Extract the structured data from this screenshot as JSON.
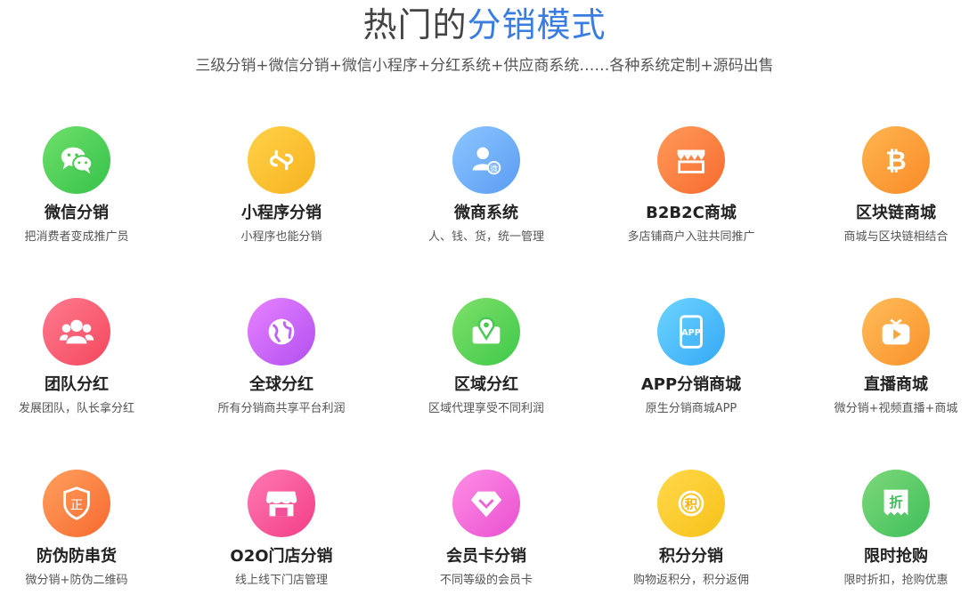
{
  "header": {
    "title_prefix": "热门的",
    "title_accent": "分销模式",
    "subtitle": "三级分销+微信分销+微信小程序+分红系统+供应商系统……各种系统定制+源码出售"
  },
  "colors": {
    "accent": "#3a7de0"
  },
  "items": [
    {
      "name": "微信分销",
      "desc": "把消费者变成推广员",
      "icon": "wechat-icon"
    },
    {
      "name": "小程序分销",
      "desc": "小程序也能分销",
      "icon": "mini-program-icon"
    },
    {
      "name": "微商系统",
      "desc": "人、钱、货，统一管理",
      "icon": "weishang-user-icon"
    },
    {
      "name": "B2B2C商城",
      "desc": "多店铺商户入驻共同推广",
      "icon": "storefront-icon"
    },
    {
      "name": "区块链商城",
      "desc": "商城与区块链相结合",
      "icon": "bitcoin-icon"
    },
    {
      "name": "团队分红",
      "desc": "发展团队，队长拿分红",
      "icon": "team-icon"
    },
    {
      "name": "全球分红",
      "desc": "所有分销商共享平台利润",
      "icon": "globe-icon"
    },
    {
      "name": "区域分红",
      "desc": "区域代理享受不同利润",
      "icon": "map-pin-icon"
    },
    {
      "name": "APP分销商城",
      "desc": "原生分销商城APP",
      "icon": "app-phone-icon"
    },
    {
      "name": "直播商城",
      "desc": "微分销+视频直播+商城",
      "icon": "live-tv-icon"
    },
    {
      "name": "防伪防串货",
      "desc": "微分销+防伪二维码",
      "icon": "shield-icon",
      "icon_text": "正"
    },
    {
      "name": "O2O门店分销",
      "desc": "线上线下门店管理",
      "icon": "shop-icon"
    },
    {
      "name": "会员卡分销",
      "desc": "不同等级的会员卡",
      "icon": "diamond-icon"
    },
    {
      "name": "积分分销",
      "desc": "购物返积分，积分返佣",
      "icon": "points-coin-icon",
      "icon_text": "积"
    },
    {
      "name": "限时抢购",
      "desc": "限时折扣，抢购优惠",
      "icon": "discount-icon",
      "icon_text": "折"
    }
  ]
}
